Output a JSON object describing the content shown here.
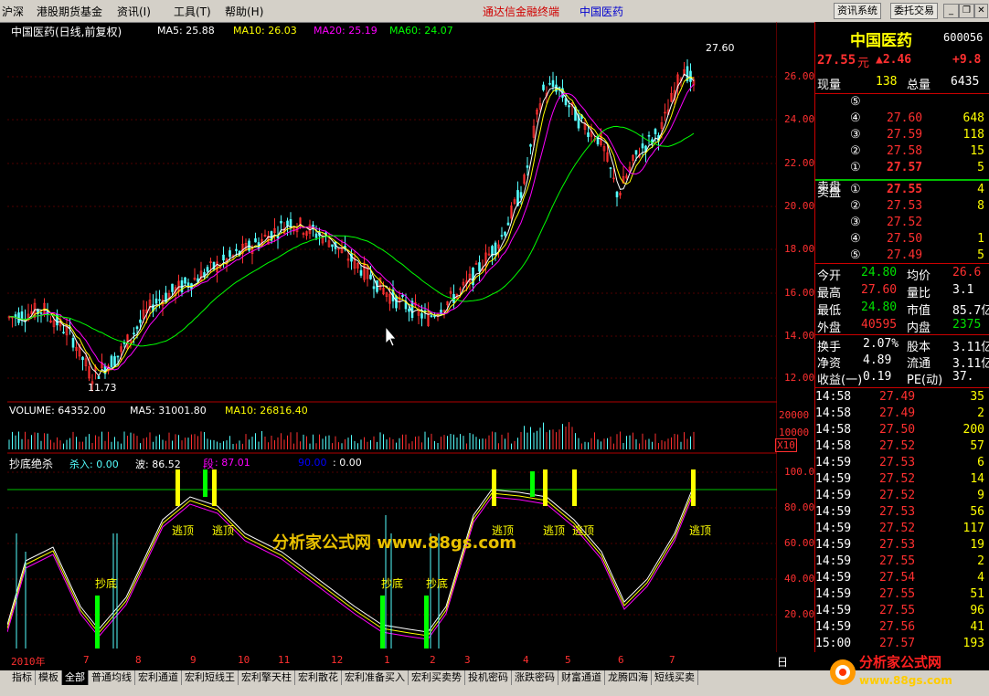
{
  "menu": {
    "items": [
      "沪深",
      "港股期货基金",
      "资讯(I)",
      "工具(T)",
      "帮助(H)"
    ],
    "app_title": "通达信金融终端",
    "stock_title": "中国医药",
    "btn_news": "资讯系统",
    "btn_trade": "委托交易"
  },
  "chart": {
    "header": {
      "name": "中国医药(日线,前复权)",
      "ma5": "MA5: 25.88",
      "ma10": "MA10: 26.03",
      "ma20": "MA20: 25.19",
      "ma60": "MA60: 24.07"
    },
    "price_axis": [
      "26.00",
      "24.00",
      "22.00",
      "20.00",
      "18.00",
      "16.00",
      "14.00",
      "12.00"
    ],
    "high_marker": "27.60",
    "low_marker": "11.73",
    "volume_header": {
      "volume": "VOLUME: 64352.00",
      "ma5": "MA5: 31001.80",
      "ma10": "MA10: 26816.40"
    },
    "volume_axis": [
      "20000",
      "10000"
    ],
    "volume_unit": "X10",
    "indicator_header": {
      "name": "抄底绝杀",
      "buy": "杀入: 0.00",
      "wave": "波: 86.52",
      "seg_label": "段",
      "seg": ": 87.01",
      "level": "90.00",
      "zero": ": 0.00"
    },
    "indicator_axis": [
      "100.0",
      "80.00",
      "60.00",
      "40.00",
      "20.00"
    ],
    "signals": {
      "top": "逃顶",
      "bottom": "抄底"
    },
    "watermark": "分析家公式网  www.88gs.com",
    "dates": [
      "2010年",
      "7",
      "8",
      "9",
      "10",
      "11",
      "12",
      "1",
      "2",
      "3",
      "4",
      "5",
      "6",
      "7"
    ],
    "period": "日线",
    "colors": {
      "ma5": "#ffffff",
      "ma10": "#ffff00",
      "ma20": "#ff00ff",
      "ma60": "#00ff00",
      "up": "#ff3030",
      "down": "#54ffff"
    }
  },
  "quote": {
    "name": "中国医药",
    "code": "600056",
    "price": "27.55",
    "unit": "元",
    "change": "▲2.46",
    "pct": "+9.8",
    "vol_label": "现量",
    "vol": "138",
    "total_label": "总量",
    "total": "6435",
    "asks": [
      {
        "n": "⑤",
        "p": "",
        "v": ""
      },
      {
        "n": "④",
        "p": "27.60",
        "v": "648"
      },
      {
        "n": "③",
        "p": "27.59",
        "v": "118"
      },
      {
        "n": "②",
        "p": "27.58",
        "v": "15"
      },
      {
        "n": "①",
        "p": "27.57",
        "v": "5"
      }
    ],
    "ask_label": "卖盘",
    "bid_label": "买盘",
    "bids": [
      {
        "n": "①",
        "p": "27.55",
        "v": "4"
      },
      {
        "n": "②",
        "p": "27.53",
        "v": "8"
      },
      {
        "n": "③",
        "p": "27.52",
        "v": ""
      },
      {
        "n": "④",
        "p": "27.50",
        "v": "1"
      },
      {
        "n": "⑤",
        "p": "27.49",
        "v": "5"
      }
    ],
    "stats": [
      {
        "l1": "今开",
        "v1": "24.80",
        "l2": "均价",
        "v2": "26.6"
      },
      {
        "l1": "最高",
        "v1": "27.60",
        "l2": "量比",
        "v2": "3.1"
      },
      {
        "l1": "最低",
        "v1": "24.80",
        "l2": "市值",
        "v2": "85.7亿"
      },
      {
        "l1": "外盘",
        "v1": "40595",
        "l2": "内盘",
        "v2": "2375"
      }
    ],
    "stats2": [
      {
        "l1": "换手",
        "v1": "2.07%",
        "l2": "股本",
        "v2": "3.11亿"
      },
      {
        "l1": "净资",
        "v1": "4.89",
        "l2": "流通",
        "v2": "3.11亿"
      },
      {
        "l1": "收益(一)",
        "v1": "0.19",
        "l2": "PE(动)",
        "v2": "37."
      }
    ],
    "ticks": [
      {
        "t": "14:58",
        "p": "27.49",
        "v": "35"
      },
      {
        "t": "14:58",
        "p": "27.49",
        "v": "2"
      },
      {
        "t": "14:58",
        "p": "27.50",
        "v": "200"
      },
      {
        "t": "14:58",
        "p": "27.52",
        "v": "57"
      },
      {
        "t": "14:59",
        "p": "27.53",
        "v": "6"
      },
      {
        "t": "14:59",
        "p": "27.52",
        "v": "14"
      },
      {
        "t": "14:59",
        "p": "27.52",
        "v": "9"
      },
      {
        "t": "14:59",
        "p": "27.53",
        "v": "56"
      },
      {
        "t": "14:59",
        "p": "27.52",
        "v": "117"
      },
      {
        "t": "14:59",
        "p": "27.53",
        "v": "19"
      },
      {
        "t": "14:59",
        "p": "27.55",
        "v": "2"
      },
      {
        "t": "14:59",
        "p": "27.54",
        "v": "4"
      },
      {
        "t": "14:59",
        "p": "27.55",
        "v": "51"
      },
      {
        "t": "14:59",
        "p": "27.55",
        "v": "96"
      },
      {
        "t": "14:59",
        "p": "27.56",
        "v": "41"
      },
      {
        "t": "15:00",
        "p": "27.57",
        "v": "193"
      }
    ]
  },
  "tabs": [
    "指标",
    "模板",
    "全部",
    "普通均线",
    "宏利通道",
    "宏利短线王",
    "宏利擎天柱",
    "宏利散花",
    "宏利准备买入",
    "宏利买卖势",
    "投机密码",
    "涨跌密码",
    "财富通道",
    "龙腾四海",
    "短线买卖"
  ],
  "active_tab": "全部",
  "brand": {
    "logo": "分析家公式网",
    "url": "www.88gs.com"
  }
}
